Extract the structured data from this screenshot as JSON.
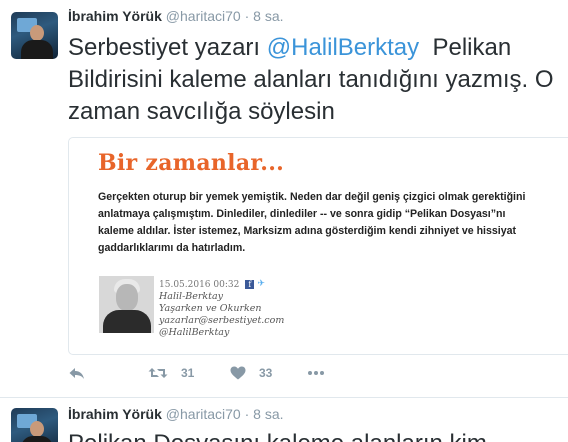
{
  "tweets": [
    {
      "author_name": "İbrahim Yörük",
      "handle": "@haritaci70",
      "separator": "·",
      "time": "8 sa.",
      "text_parts": {
        "before_mention": "Serbestiyet yazarı ",
        "mention": "@HalilBerktay",
        "after_mention": "  Pelikan",
        "line2": "Bildirisini kaleme alanları tanıdığını yazmış. O",
        "line3": "zaman savcılığa söylesin"
      },
      "card": {
        "title": "Bir zamanlar...",
        "body_lines": [
          "Gerçekten oturup bir yemek yemiştik. Neden dar değil geniş çizgici olmak gerektiğini",
          "anlatmaya çalışmıştım. Dinlediler, dinlediler -- ve sonra gidip “Pelikan Dosyası”nı",
          "kaleme aldılar. İster istemez, Marksizm adına gösterdiğim kendi zihniyet ve hissiyat",
          "gaddarlıklarımı da hatırladım."
        ],
        "signature": {
          "date": "15.05.2016 00:32",
          "name": "Halil-Berktay",
          "column": "Yaşarken ve Okurken",
          "email": "yazarlar@serbestiyet.com",
          "twitter": "@HalilBerktay"
        }
      },
      "actions": {
        "reply_icon": "reply-icon",
        "retweet_icon": "retweet-icon",
        "retweet_count": "31",
        "like_icon": "heart-icon",
        "like_count": "33",
        "more_icon": "more-icon"
      }
    },
    {
      "author_name": "İbrahim Yörük",
      "handle": "@haritaci70",
      "separator": "·",
      "time": "8 sa.",
      "text_line1": "Pelikan Dosyasını kaleme alanların kim"
    }
  ],
  "colors": {
    "link": "#3b94d9",
    "muted": "#8899a6",
    "card_title": "#e8652a",
    "border": "#e1e8ed"
  }
}
